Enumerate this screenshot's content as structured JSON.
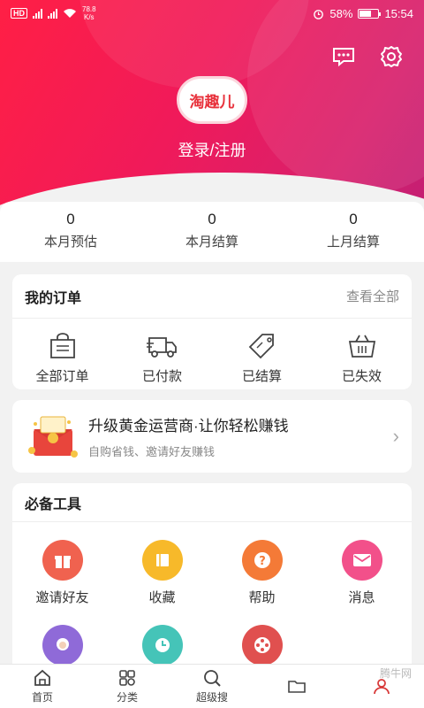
{
  "status_bar": {
    "hd": "HD",
    "net_speed_value": "78.8",
    "net_speed_unit": "K/s",
    "battery": "58%",
    "time": "15:54"
  },
  "header": {
    "logo_text": "淘趣儿",
    "login_text": "登录/注册"
  },
  "stats": [
    {
      "value": "0",
      "label": "本月预估"
    },
    {
      "value": "0",
      "label": "本月结算"
    },
    {
      "value": "0",
      "label": "上月结算"
    }
  ],
  "orders": {
    "title": "我的订单",
    "view_all": "查看全部",
    "items": [
      {
        "label": "全部订单",
        "icon": "shopping-bag-icon"
      },
      {
        "label": "已付款",
        "icon": "delivery-truck-icon"
      },
      {
        "label": "已结算",
        "icon": "sale-tag-icon"
      },
      {
        "label": "已失效",
        "icon": "basket-icon"
      }
    ]
  },
  "promo": {
    "title": "升级黄金运营商·让你轻松赚钱",
    "subtitle": "自购省钱、邀请好友赚钱"
  },
  "tools": {
    "title": "必备工具",
    "items": [
      {
        "label": "邀请好友",
        "icon": "gift-icon",
        "color": "#f0624f"
      },
      {
        "label": "收藏",
        "icon": "book-icon",
        "color": "#f7b92a"
      },
      {
        "label": "帮助",
        "icon": "question-icon",
        "color": "#f47a37"
      },
      {
        "label": "消息",
        "icon": "mail-icon",
        "color": "#f2508a"
      },
      {
        "label": "",
        "icon": "avatar-icon",
        "color": "#8f6ad8"
      },
      {
        "label": "",
        "icon": "clock-icon",
        "color": "#45c4b8"
      },
      {
        "label": "",
        "icon": "film-reel-icon",
        "color": "#e0504f"
      }
    ]
  },
  "tabbar": [
    {
      "label": "首页",
      "icon": "home-icon"
    },
    {
      "label": "分类",
      "icon": "category-grid-icon"
    },
    {
      "label": "超级搜",
      "icon": "search-icon"
    },
    {
      "label": "",
      "icon": "folder-icon"
    },
    {
      "label": "",
      "icon": "profile-icon"
    }
  ],
  "watermark": "腾牛网"
}
